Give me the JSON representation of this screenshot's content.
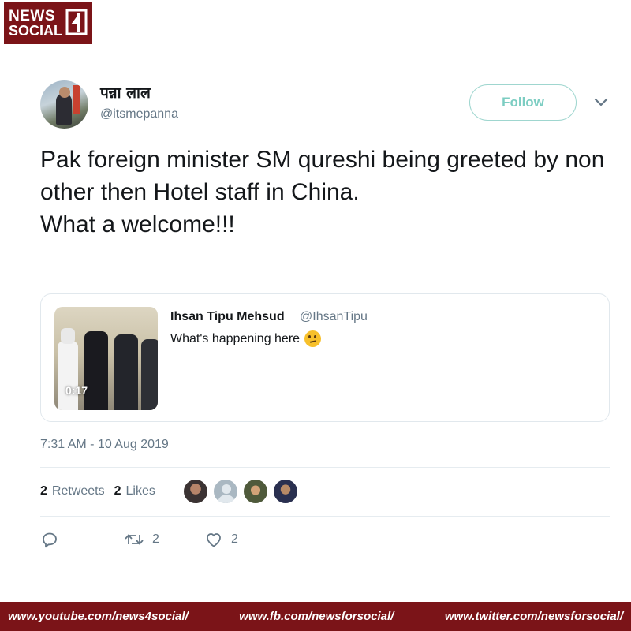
{
  "brand": {
    "line1": "NEWS",
    "line2": "SOCIAL",
    "accent": "#7b1418"
  },
  "tweet": {
    "display_name": "पन्ना लाल",
    "handle": "@itsmepanna",
    "follow_label": "Follow",
    "text": "Pak foreign minister SM qureshi being greeted by non other then Hotel staff in China.\nWhat a welcome!!!",
    "timestamp": "7:31 AM - 10 Aug 2019",
    "retweets_count": "2",
    "retweets_label": "Retweets",
    "likes_count": "2",
    "likes_label": "Likes",
    "retweet_action_count": "2",
    "like_action_count": "2"
  },
  "quoted": {
    "name": "Ihsan Tipu Mehsud",
    "handle": "@IhsanTipu",
    "text": "What's happening here",
    "video_duration": "0:17",
    "emoji": "thinking-face-icon"
  },
  "footer": {
    "youtube": "www.youtube.com/news4social/",
    "facebook": "www.fb.com/newsforsocial/",
    "twitter": "www.twitter.com/newsforsocial/"
  },
  "colors": {
    "follow": "#7ccdc2",
    "muted": "#657786",
    "text": "#14171a"
  }
}
